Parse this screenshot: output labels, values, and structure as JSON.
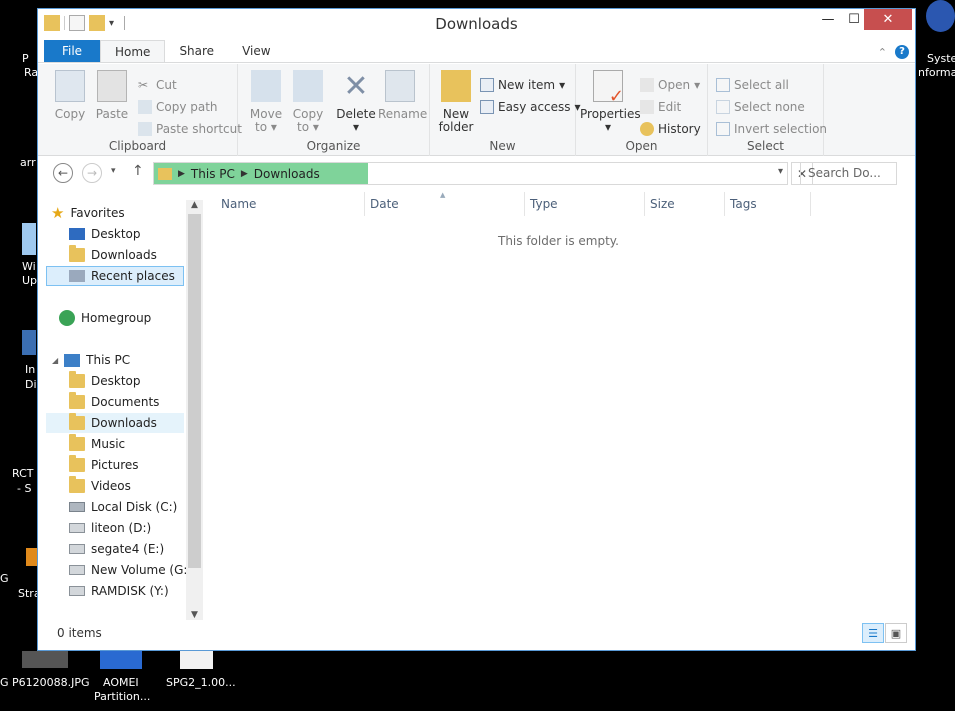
{
  "window": {
    "title": "Downloads",
    "minimize": "—",
    "maximize": "☐",
    "close": "✕"
  },
  "ribbon_tabs": [
    "File",
    "Home",
    "Share",
    "View"
  ],
  "clipboard": {
    "label": "Clipboard",
    "copy": "Copy",
    "paste": "Paste",
    "cut": "Cut",
    "copy_path": "Copy path",
    "paste_shortcut": "Paste shortcut"
  },
  "organize": {
    "label": "Organize",
    "move_to": "Move to",
    "copy_to": "Copy to",
    "delete": "Delete",
    "rename": "Rename"
  },
  "new": {
    "label": "New",
    "new_folder": "New folder",
    "new_item": "New item",
    "easy_access": "Easy access"
  },
  "open": {
    "label": "Open",
    "properties": "Properties",
    "open": "Open",
    "edit": "Edit",
    "history": "History"
  },
  "select": {
    "label": "Select",
    "select_all": "Select all",
    "select_none": "Select none",
    "invert_selection": "Invert selection"
  },
  "address": {
    "crumbs": [
      "This PC",
      "Downloads"
    ],
    "search_placeholder": "Search Do..."
  },
  "nav": {
    "favorites": "Favorites",
    "fav_items": [
      "Desktop",
      "Downloads",
      "Recent places"
    ],
    "homegroup": "Homegroup",
    "this_pc": "This PC",
    "pc_items": [
      "Desktop",
      "Documents",
      "Downloads",
      "Music",
      "Pictures",
      "Videos",
      "Local Disk (C:)",
      "liteon (D:)",
      "segate4 (E:)",
      "New Volume (G:)",
      "RAMDISK (Y:)"
    ]
  },
  "columns": [
    "Name",
    "Date",
    "Type",
    "Size",
    "Tags"
  ],
  "empty_message": "This folder is empty.",
  "status": "0 items",
  "desktop": {
    "labels": [
      "P",
      "Ra",
      "arr",
      "Wi",
      "Up",
      "In",
      "Di",
      "RCT",
      "- S",
      "G",
      "Stra",
      "Syste",
      "nforma",
      "G P6120088.JPG",
      "AOMEI",
      "Partition...",
      "SPG2_1.00..."
    ]
  },
  "colors": {
    "accent": "#1979ca",
    "selection": "#7fd39a",
    "close": "#c74f4f"
  }
}
